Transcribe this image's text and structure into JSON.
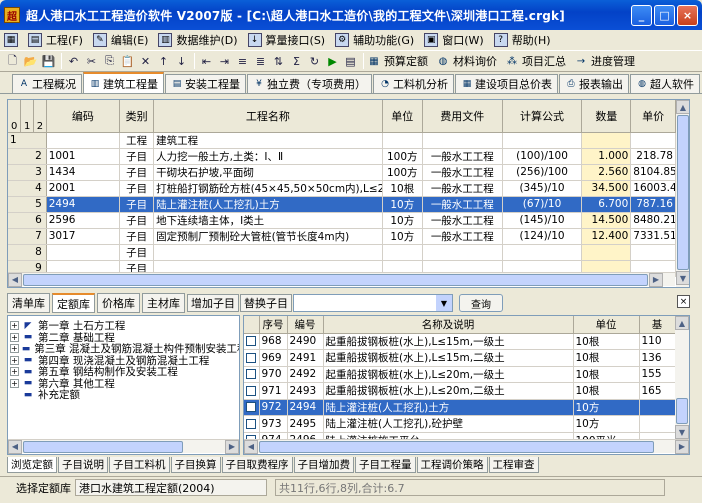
{
  "window": {
    "title": "超人港口水工工程造价软件 V2007版 - [C:\\超人港口水工造价\\我的工程文件\\深圳港口工程.crgk]",
    "minimize": "_",
    "maximize": "□",
    "close": "×"
  },
  "menu": [
    {
      "label": "工程(F)",
      "icon": "project-icon"
    },
    {
      "label": "编辑(E)",
      "icon": "edit-icon"
    },
    {
      "label": "数据维护(D)",
      "icon": "database-icon"
    },
    {
      "label": "算量接口(S)",
      "icon": "arrow-down-icon"
    },
    {
      "label": "辅助功能(G)",
      "icon": "tools-icon"
    },
    {
      "label": "窗口(W)",
      "icon": "window-icon"
    },
    {
      "label": "帮助(H)",
      "icon": "help-icon"
    }
  ],
  "toolbar": {
    "icons": [
      "new-file",
      "open",
      "save",
      "undo",
      "cut",
      "copy",
      "paste",
      "delete",
      "move-up",
      "move-down",
      "indent-1",
      "indent-2",
      "indent-3",
      "indent-4",
      "sort",
      "calc",
      "refresh",
      "play",
      "export"
    ],
    "text_buttons": [
      {
        "label": "预算定额",
        "icon": "book-icon"
      },
      {
        "label": "材料询价",
        "icon": "globe-icon"
      },
      {
        "label": "项目汇总",
        "icon": "sum-icon"
      },
      {
        "label": "进度管理",
        "icon": "schedule-icon"
      }
    ]
  },
  "main_tabs": [
    {
      "label": "工程概况",
      "icon": "a-icon",
      "active": false
    },
    {
      "label": "建筑工程量",
      "icon": "building-icon",
      "active": true
    },
    {
      "label": "安装工程量",
      "icon": "install-icon",
      "active": false
    },
    {
      "label": "独立费（专项费用）",
      "icon": "money-icon",
      "active": false
    },
    {
      "label": "工料机分析",
      "icon": "analysis-icon",
      "active": false
    },
    {
      "label": "建设项目总价表",
      "icon": "table-icon",
      "active": false
    },
    {
      "label": "报表输出",
      "icon": "report-icon",
      "active": false
    },
    {
      "label": "超人软件",
      "icon": "globe-icon",
      "active": false
    }
  ],
  "main_grid": {
    "levels": [
      "0",
      "1",
      "2"
    ],
    "columns": [
      "编码",
      "类别",
      "工程名称",
      "单位",
      "费用文件",
      "计算公式",
      "数量",
      "单价"
    ],
    "rows": [
      {
        "n": "1",
        "code": "",
        "type": "工程",
        "name": "建筑工程",
        "unit": "",
        "fee": "",
        "formula": "",
        "qty": "",
        "price": "",
        "group": true
      },
      {
        "n": "2",
        "code": "1001",
        "type": "子目",
        "name": "人力挖一般土方,土类：Ⅰ、Ⅱ",
        "unit": "100方",
        "fee": "一般水工工程",
        "formula": "(100)/100",
        "qty": "1.000",
        "price": "218.78"
      },
      {
        "n": "3",
        "code": "1434",
        "type": "子目",
        "name": "干砌块石护坡,平面砌",
        "unit": "100方",
        "fee": "一般水工工程",
        "formula": "(256)/100",
        "qty": "2.560",
        "price": "8104.85"
      },
      {
        "n": "4",
        "code": "2001",
        "type": "子目",
        "name": "打桩船打钢筋砼方桩(45×45,50×50cm内),L≤26m,一级",
        "unit": "10根",
        "fee": "一般水工工程",
        "formula": "(345)/10",
        "qty": "34.500",
        "price": "16003.4"
      },
      {
        "n": "5",
        "code": "2494",
        "type": "子目",
        "name": "陆上灌注桩(人工挖孔)土方",
        "unit": "10方",
        "fee": "一般水工工程",
        "formula": "(67)/10",
        "qty": "6.700",
        "price": "787.16",
        "selected": true
      },
      {
        "n": "6",
        "code": "2596",
        "type": "子目",
        "name": "地下连续墙主体，Ⅰ类土",
        "unit": "10方",
        "fee": "一般水工工程",
        "formula": "(145)/10",
        "qty": "14.500",
        "price": "8480.21"
      },
      {
        "n": "7",
        "code": "3017",
        "type": "子目",
        "name": "固定预制厂预制砼大管桩(管节长度4m内)",
        "unit": "10方",
        "fee": "一般水工工程",
        "formula": "(124)/10",
        "qty": "12.400",
        "price": "7331.51"
      },
      {
        "n": "8",
        "code": "",
        "type": "子目",
        "name": "",
        "unit": "",
        "fee": "",
        "formula": "",
        "qty": "",
        "price": ""
      },
      {
        "n": "9",
        "code": "",
        "type": "子目",
        "name": "",
        "unit": "",
        "fee": "",
        "formula": "",
        "qty": "",
        "price": ""
      }
    ]
  },
  "lower_tabs": [
    "清单库",
    "定额库",
    "价格库",
    "主材库"
  ],
  "lower_buttons": [
    "增加子目",
    "替换子目"
  ],
  "lower_combo_value": "",
  "query_button": "查询",
  "tree": [
    {
      "label": "第一章  土石方工程",
      "expander": "+"
    },
    {
      "label": "第二章  基础工程",
      "expander": "+"
    },
    {
      "label": "第三章  混凝土及钢筋混凝土构件预制安装工程",
      "expander": "+"
    },
    {
      "label": "第四章  现浇混凝土及钢筋混凝土工程",
      "expander": "+"
    },
    {
      "label": "第五章  钢结构制作及安装工程",
      "expander": "+"
    },
    {
      "label": "第六章  其他工程",
      "expander": "+"
    },
    {
      "label": "补充定额",
      "expander": ""
    }
  ],
  "quota_grid": {
    "columns": [
      "",
      "序号",
      "编号",
      "名称及说明",
      "单位",
      "基"
    ],
    "rows": [
      {
        "seq": "968",
        "code": "2490",
        "name": "起重船拔钢板桩(水上),L≤15m,一级土",
        "unit": "10根",
        "base": "110"
      },
      {
        "seq": "969",
        "code": "2491",
        "name": "起重船拔钢板桩(水上),L≤15m,二级土",
        "unit": "10根",
        "base": "136"
      },
      {
        "seq": "970",
        "code": "2492",
        "name": "起重船拔钢板桩(水上),L≤20m,一级土",
        "unit": "10根",
        "base": "155"
      },
      {
        "seq": "971",
        "code": "2493",
        "name": "起重船拔钢板桩(水上),L≤20m,二级土",
        "unit": "10根",
        "base": "165"
      },
      {
        "seq": "972",
        "code": "2494",
        "name": "陆上灌注桩(人工挖孔)土方",
        "unit": "10方",
        "base": "",
        "selected": true
      },
      {
        "seq": "973",
        "code": "2495",
        "name": "陆上灌注桩(人工挖孔),砼护壁",
        "unit": "10方",
        "base": ""
      },
      {
        "seq": "974",
        "code": "2496",
        "name": "陆上灌注桩施工平台",
        "unit": "100平米",
        "base": ""
      }
    ]
  },
  "bottom_tabs": [
    "浏览定额",
    "子目说明",
    "子目工料机",
    "子目换算",
    "子目取费程序",
    "子目增加费",
    "子目工程量",
    "工程调价策略",
    "工程审查"
  ],
  "status": {
    "label": "选择定额库",
    "value": "港口水建筑工程定额(2004)",
    "info": "共11行,6行,8列,合计:6.7"
  }
}
